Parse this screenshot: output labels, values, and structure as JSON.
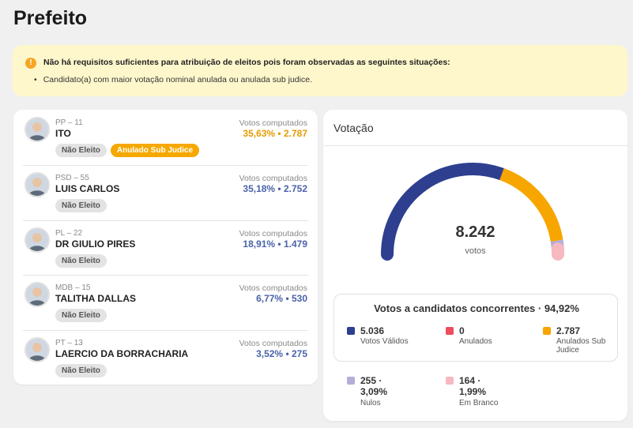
{
  "page": {
    "title": "Prefeito"
  },
  "alert": {
    "icon": "warning-icon",
    "title": "Não há requisitos suficientes para atribuição de eleitos pois foram observadas as seguintes situações:",
    "bullet": "Candidato(a) com maior votação nominal anulada ou anulada sub judice."
  },
  "candidates": [
    {
      "party": "PP – 11",
      "name": "ITO",
      "votes_label": "Votos computados",
      "percent": "35,63%",
      "votes": "2.787",
      "badges": [
        "Não Eleito",
        "Anulado Sub Judice"
      ],
      "color": "#e69c00",
      "share": 0.3563
    },
    {
      "party": "PSD – 55",
      "name": "LUIS CARLOS",
      "votes_label": "Votos computados",
      "percent": "35,18%",
      "votes": "2.752",
      "badges": [
        "Não Eleito"
      ],
      "color": "#4a63a8",
      "share": 0.3518
    },
    {
      "party": "PL – 22",
      "name": "DR GIULIO PIRES",
      "votes_label": "Votos computados",
      "percent": "18,91%",
      "votes": "1.479",
      "badges": [
        "Não Eleito"
      ],
      "color": "#4a63a8",
      "share": 0.1891
    },
    {
      "party": "MDB – 15",
      "name": "TALITHA DALLAS",
      "votes_label": "Votos computados",
      "percent": "6,77%",
      "votes": "530",
      "badges": [
        "Não Eleito"
      ],
      "color": "#4a63a8",
      "share": 0.0677
    },
    {
      "party": "PT – 13",
      "name": "LAERCIO DA BORRACHARIA",
      "votes_label": "Votos computados",
      "percent": "3,52%",
      "votes": "275",
      "badges": [
        "Não Eleito"
      ],
      "color": "#4a63a8",
      "share": 0.0352
    }
  ],
  "votacao": {
    "title": "Votação",
    "total": "8.242",
    "total_label": "votos",
    "summary_title": "Votos a candidatos concorrentes · 94,92%",
    "stats": [
      {
        "value": "5.036",
        "label": "Votos Válidos",
        "color": "#2e3f8f"
      },
      {
        "value": "0",
        "label": "Anulados",
        "color": "#ee4d5f"
      },
      {
        "value": "2.787",
        "label": "Anulados Sub Judice",
        "color": "#f7a600"
      },
      {
        "value": "255 · 3,09%",
        "label": "Nulos",
        "color": "#b3aed6"
      },
      {
        "value": "164 · 1,99%",
        "label": "Em Branco",
        "color": "#f7b8c0"
      }
    ],
    "gauge_segments": [
      {
        "name": "Votos Válidos",
        "count": 5036,
        "color": "#2e3f8f"
      },
      {
        "name": "Anulados Sub Judice",
        "count": 2787,
        "color": "#f7a600"
      },
      {
        "name": "Nulos",
        "count": 255,
        "color": "#b3aed6"
      },
      {
        "name": "Em Branco",
        "count": 164,
        "color": "#f7b8c0"
      }
    ]
  }
}
